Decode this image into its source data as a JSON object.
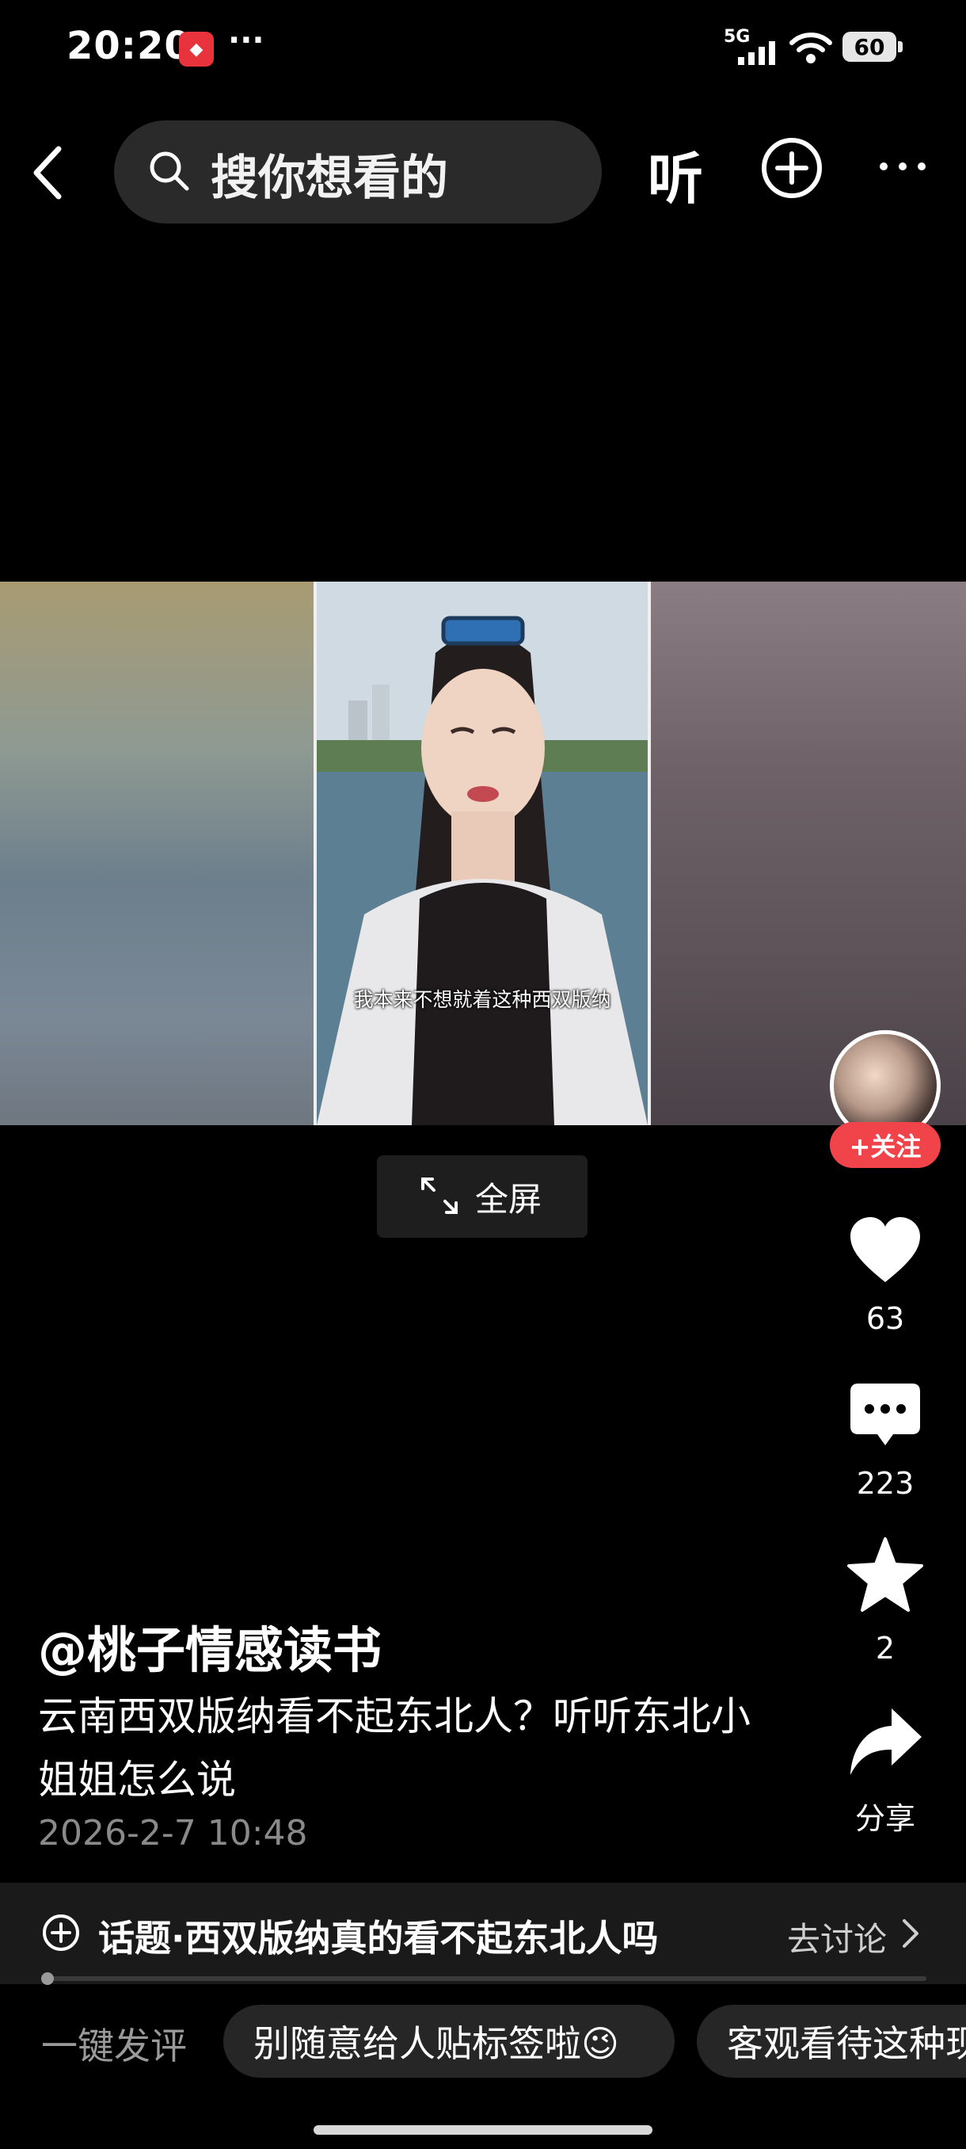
{
  "status_bar": {
    "time": "20:20",
    "notification_dots": "···",
    "network": "5G",
    "battery": "60"
  },
  "top_nav": {
    "search_placeholder": "搜你想看的",
    "listen_label": "听",
    "icons": [
      "back-icon",
      "search-icon",
      "add-icon",
      "more-icon"
    ]
  },
  "video": {
    "caption": "我本来不想就着这种西双版纳",
    "fullscreen_label": "全屏"
  },
  "rail": {
    "follow_label": "+关注",
    "likes": "63",
    "comments": "223",
    "favorites": "2",
    "share_label": "分享"
  },
  "post": {
    "author": "@桃子情感读书",
    "description": "云南西双版纳看不起东北人？听听东北小姐姐怎么说",
    "timestamp": "2026-2-7 10:48"
  },
  "topic": {
    "text": "话题·西双版纳真的看不起东北人吗",
    "action": "去讨论"
  },
  "quick_comments": {
    "label": "一键发评",
    "chips": [
      "别随意给人贴标签啦😉",
      "客观看待这种现"
    ]
  },
  "colors": {
    "follow": "#f0434a",
    "background": "#000000"
  }
}
